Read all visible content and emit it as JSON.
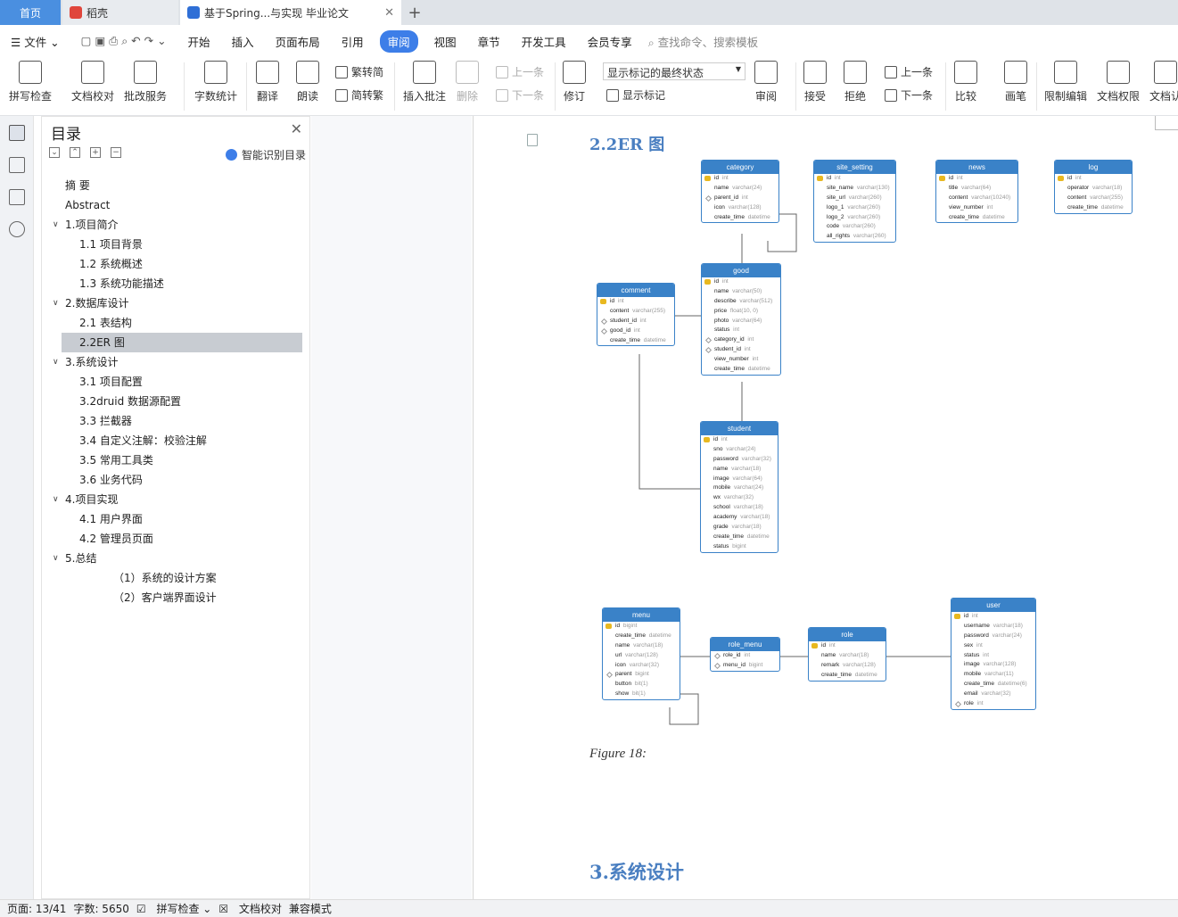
{
  "tabs": {
    "home": "首页",
    "daoke": "稻壳",
    "doc": "基于Spring...与实现 毕业论文",
    "add": "+"
  },
  "menu": {
    "file": "文件",
    "items": [
      "开始",
      "插入",
      "页面布局",
      "引用",
      "审阅",
      "视图",
      "章节",
      "开发工具",
      "会员专享"
    ],
    "active": "审阅",
    "search": "查找命令、搜索模板"
  },
  "ribbon": {
    "spell": "拼写检查",
    "check": "文档校对",
    "batch": "批改服务",
    "count": "字数统计",
    "translate": "翻译",
    "read": "朗读",
    "t2s": "繁转简",
    "s2t": "简转繁",
    "insert_comment": "插入批注",
    "delete": "删除",
    "prev": "上一条",
    "next": "下一条",
    "revise": "修订",
    "combo": "显示标记的最终状态",
    "show_marks": "显示标记",
    "review": "审阅",
    "accept": "接受",
    "reject": "拒绝",
    "prev2": "上一条",
    "next2": "下一条",
    "compare": "比较",
    "pen": "画笔",
    "restrict": "限制编辑",
    "perm": "文档权限",
    "doc_cert": "文档认"
  },
  "toc": {
    "title": "目录",
    "smart": "智能识别目录",
    "items": [
      {
        "text": "摘  要",
        "level": 1,
        "arrow": ""
      },
      {
        "text": "Abstract",
        "level": 1,
        "arrow": ""
      },
      {
        "text": "1.项目简介",
        "level": 0,
        "arrow": "v"
      },
      {
        "text": "1.1 项目背景",
        "level": 2,
        "arrow": ""
      },
      {
        "text": "1.2 系统概述",
        "level": 2,
        "arrow": ""
      },
      {
        "text": "1.3 系统功能描述",
        "level": 2,
        "arrow": ""
      },
      {
        "text": "2.数据库设计",
        "level": 0,
        "arrow": "v"
      },
      {
        "text": "2.1 表结构",
        "level": 2,
        "arrow": ""
      },
      {
        "text": "2.2ER 图",
        "level": 2,
        "arrow": "",
        "selected": true
      },
      {
        "text": "3.系统设计",
        "level": 0,
        "arrow": "v"
      },
      {
        "text": "3.1 项目配置",
        "level": 2,
        "arrow": ""
      },
      {
        "text": "3.2druid 数据源配置",
        "level": 2,
        "arrow": ""
      },
      {
        "text": "3.3 拦截器",
        "level": 2,
        "arrow": ""
      },
      {
        "text": "3.4 自定义注解：校验注解",
        "level": 2,
        "arrow": ""
      },
      {
        "text": "3.5 常用工具类",
        "level": 2,
        "arrow": ""
      },
      {
        "text": "3.6 业务代码",
        "level": 2,
        "arrow": ""
      },
      {
        "text": "4.项目实现",
        "level": 0,
        "arrow": "v"
      },
      {
        "text": "4.1 用户界面",
        "level": 2,
        "arrow": ""
      },
      {
        "text": "4.2 管理员页面",
        "level": 2,
        "arrow": ""
      },
      {
        "text": "5.总结",
        "level": 0,
        "arrow": "v"
      },
      {
        "text": "（1）系统的设计方案",
        "level": 3,
        "arrow": ""
      },
      {
        "text": "（2）客户端界面设计",
        "level": 3,
        "arrow": ""
      }
    ]
  },
  "document": {
    "heading": "2.2ER 图",
    "caption": "Figure 18:",
    "next_heading": "3.系统设计"
  },
  "er_tables": [
    {
      "name": "category",
      "fields": [
        [
          "k",
          "id",
          "int"
        ],
        [
          "",
          "name",
          "varchar(24)"
        ],
        [
          "d",
          "parent_id",
          "int"
        ],
        [
          "",
          "icon",
          "varchar(128)"
        ],
        [
          "",
          "create_time",
          "datetime"
        ]
      ]
    },
    {
      "name": "site_setting",
      "fields": [
        [
          "k",
          "id",
          "int"
        ],
        [
          "",
          "site_name",
          "varchar(130)"
        ],
        [
          "",
          "site_url",
          "varchar(260)"
        ],
        [
          "",
          "logo_1",
          "varchar(260)"
        ],
        [
          "",
          "logo_2",
          "varchar(260)"
        ],
        [
          "",
          "code",
          "varchar(260)"
        ],
        [
          "",
          "all_rights",
          "varchar(260)"
        ]
      ]
    },
    {
      "name": "news",
      "fields": [
        [
          "k",
          "id",
          "int"
        ],
        [
          "",
          "title",
          "varchar(64)"
        ],
        [
          "",
          "content",
          "varchar(10240)"
        ],
        [
          "",
          "view_number",
          "int"
        ],
        [
          "",
          "create_time",
          "datetime"
        ]
      ]
    },
    {
      "name": "log",
      "fields": [
        [
          "k",
          "id",
          "int"
        ],
        [
          "",
          "operator",
          "varchar(18)"
        ],
        [
          "",
          "content",
          "varchar(255)"
        ],
        [
          "",
          "create_time",
          "datetime"
        ]
      ]
    },
    {
      "name": "comment",
      "fields": [
        [
          "k",
          "id",
          "int"
        ],
        [
          "",
          "content",
          "varchar(255)"
        ],
        [
          "d",
          "student_id",
          "int"
        ],
        [
          "d",
          "good_id",
          "int"
        ],
        [
          "",
          "create_time",
          "datetime"
        ]
      ]
    },
    {
      "name": "good",
      "fields": [
        [
          "k",
          "id",
          "int"
        ],
        [
          "",
          "name",
          "varchar(50)"
        ],
        [
          "",
          "describe",
          "varchar(512)"
        ],
        [
          "",
          "price",
          "float(10, 0)"
        ],
        [
          "",
          "photo",
          "varchar(64)"
        ],
        [
          "",
          "status",
          "int"
        ],
        [
          "d",
          "category_id",
          "int"
        ],
        [
          "d",
          "student_id",
          "int"
        ],
        [
          "",
          "view_number",
          "int"
        ],
        [
          "",
          "create_time",
          "datetime"
        ]
      ]
    },
    {
      "name": "student",
      "fields": [
        [
          "k",
          "id",
          "int"
        ],
        [
          "",
          "sno",
          "varchar(24)"
        ],
        [
          "",
          "password",
          "varchar(32)"
        ],
        [
          "",
          "name",
          "varchar(18)"
        ],
        [
          "",
          "image",
          "varchar(64)"
        ],
        [
          "",
          "mobile",
          "varchar(24)"
        ],
        [
          "",
          "wx",
          "varchar(32)"
        ],
        [
          "",
          "school",
          "varchar(18)"
        ],
        [
          "",
          "academy",
          "varchar(18)"
        ],
        [
          "",
          "grade",
          "varchar(18)"
        ],
        [
          "",
          "create_time",
          "datetime"
        ],
        [
          "",
          "status",
          "bigint"
        ]
      ]
    },
    {
      "name": "menu",
      "fields": [
        [
          "k",
          "id",
          "bigint"
        ],
        [
          "",
          "create_time",
          "datetime"
        ],
        [
          "",
          "name",
          "varchar(18)"
        ],
        [
          "",
          "url",
          "varchar(128)"
        ],
        [
          "",
          "icon",
          "varchar(32)"
        ],
        [
          "d",
          "parent",
          "bigint"
        ],
        [
          "",
          "button",
          "bit(1)"
        ],
        [
          "",
          "show",
          "bit(1)"
        ]
      ]
    },
    {
      "name": "role_menu",
      "fields": [
        [
          "d",
          "role_id",
          "int"
        ],
        [
          "d",
          "menu_id",
          "bigint"
        ]
      ]
    },
    {
      "name": "role",
      "fields": [
        [
          "k",
          "id",
          "int"
        ],
        [
          "",
          "name",
          "varchar(18)"
        ],
        [
          "",
          "remark",
          "varchar(128)"
        ],
        [
          "",
          "create_time",
          "datetime"
        ]
      ]
    },
    {
      "name": "user",
      "fields": [
        [
          "k",
          "id",
          "int"
        ],
        [
          "",
          "username",
          "varchar(18)"
        ],
        [
          "",
          "password",
          "varchar(24)"
        ],
        [
          "",
          "sex",
          "int"
        ],
        [
          "",
          "status",
          "int"
        ],
        [
          "",
          "image",
          "varchar(128)"
        ],
        [
          "",
          "mobile",
          "varchar(11)"
        ],
        [
          "",
          "create_time",
          "datetime(6)"
        ],
        [
          "",
          "email",
          "varchar(32)"
        ],
        [
          "d",
          "role",
          "int"
        ]
      ]
    }
  ],
  "status": {
    "page": "页面: 13/41",
    "words": "字数: 5650",
    "spell": "拼写检查",
    "check": "文档校对",
    "compat": "兼容模式"
  },
  "colors": {
    "accent": "#3d7ee8",
    "heading": "#4a7fc1",
    "table_header": "#3a82c8"
  }
}
